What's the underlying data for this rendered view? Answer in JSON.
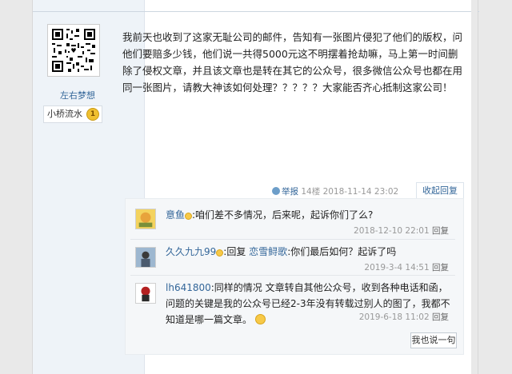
{
  "post": {
    "username": "左右梦想",
    "badge_text": "小桥流水",
    "badge_medal": "1",
    "content": "我前天也收到了这家无耻公司的邮件，告知有一张图片侵犯了他们的版权，问他们要赔多少钱，他们说一共得5000元这不明摆着抢劫嘛，马上第一时间删除了侵权文章，并且该文章也是转在其它的公众号，很多微信公众号也都在用同一张图片，请教大神该如何处理？？？？？大家能否齐心抵制这家公司！",
    "report_label": "举报",
    "floor": "14楼",
    "timestamp": "2018-11-14 23:02",
    "collapse_label": "收起回复"
  },
  "replies": [
    {
      "name": "意鱼",
      "text": ":咱们差不多情况，后来呢，起诉你们了么?",
      "time": "2018-12-10 22:01",
      "reply_label": "回复"
    },
    {
      "name": "久久九九99",
      "reply_word": "回复",
      "target": "恋雪鲟歌",
      "text": ":你们最后如何？起诉了吗",
      "time": "2019-3-4 14:51",
      "reply_label": "回复"
    },
    {
      "name": "lh641800",
      "text": ":同样的情况 文章转自其他公众号，收到各种电话和函，问题的关键是我的公众号已经2-3年没有转载过别人的图了，我都不知道是哪一篇文章。",
      "time": "2019-6-18 11:02",
      "reply_label": "回复"
    }
  ],
  "say_button": "我也说一句",
  "colors": {
    "link": "#336699",
    "side_bg": "#eef3f8",
    "reply_bg": "#f5f7f9"
  }
}
